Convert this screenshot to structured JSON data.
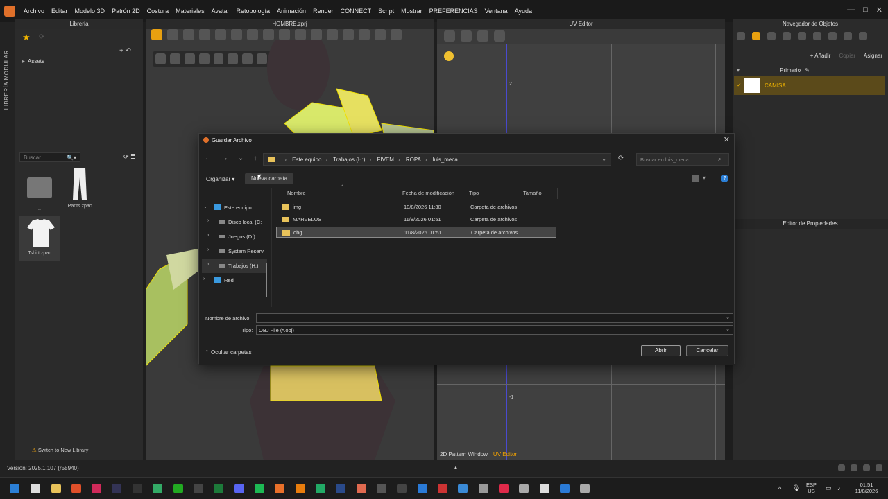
{
  "app": {
    "menu": [
      "Archivo",
      "Editar",
      "Modelo 3D",
      "Patrón 2D",
      "Costura",
      "Materiales",
      "Avatar",
      "Retopología",
      "Animación",
      "Render",
      "CONNECT",
      "Script",
      "Mostrar",
      "PREFERENCIAS",
      "Ventana",
      "Ayuda"
    ],
    "window_controls": [
      "—",
      "□",
      "✕"
    ],
    "left_strip": "LIBRERÍA MODULAR",
    "version": "Version: 2025.1.107 (r55940)"
  },
  "library": {
    "title": "Librería",
    "assets": "Assets",
    "search_placeholder": "Buscar",
    "items": [
      {
        "label": ".."
      },
      {
        "label": "Pants.zpac"
      },
      {
        "label": "Tshirt.zpac"
      }
    ],
    "switch": "Switch to New Library"
  },
  "viewport": {
    "title": "HOMBRE.zprj"
  },
  "uv_editor": {
    "title": "UV Editor",
    "tick_top": "2",
    "tick_bottom": "-1",
    "tabs": [
      "2D Pattern Window",
      "UV Editor"
    ]
  },
  "navigator": {
    "title": "Navegador de Objetos",
    "add": "+ Añadir",
    "copy": "Copiar",
    "assign": "Asignar",
    "primary": "Primario",
    "item": "CAMISA",
    "properties": "Editor de Propiedades"
  },
  "dialog": {
    "title": "Guardar Archivo",
    "path": [
      "Este equipo",
      "Trabajos (H:)",
      "FIVEM",
      "ROPA",
      "luis_meca"
    ],
    "search_placeholder": "Buscar en luis_meca",
    "organize": "Organizar",
    "new_folder": "Nueva carpeta",
    "tree": [
      {
        "label": "Este equipo",
        "level": 0,
        "expanded": true
      },
      {
        "label": "Disco local (C:",
        "level": 1
      },
      {
        "label": "Juegos (D:)",
        "level": 1
      },
      {
        "label": "System Reserv",
        "level": 1
      },
      {
        "label": "Trabajos (H:)",
        "level": 1,
        "selected": true
      },
      {
        "label": "Red",
        "level": 0
      }
    ],
    "columns": [
      "Nombre",
      "Fecha de modificación",
      "Tipo",
      "Tamaño"
    ],
    "files": [
      {
        "name": "img",
        "date": "10/8/2026 11:30",
        "type": "Carpeta de archivos"
      },
      {
        "name": "MARVELUS",
        "date": "11/8/2026 01:51",
        "type": "Carpeta de archivos"
      },
      {
        "name": "obg",
        "date": "11/8/2026 01:51",
        "type": "Carpeta de archivos",
        "selected": true
      }
    ],
    "filename_label": "Nombre de archivo:",
    "filename_value": "",
    "type_label": "Tipo:",
    "type_value": "OBJ File (*.obj)",
    "hide_folders": "Ocultar carpetas",
    "open": "Abrir",
    "cancel": "Cancelar"
  },
  "tray": {
    "lang": "ESP",
    "region": "US",
    "time": "01:51",
    "date": "11/8/2026"
  }
}
